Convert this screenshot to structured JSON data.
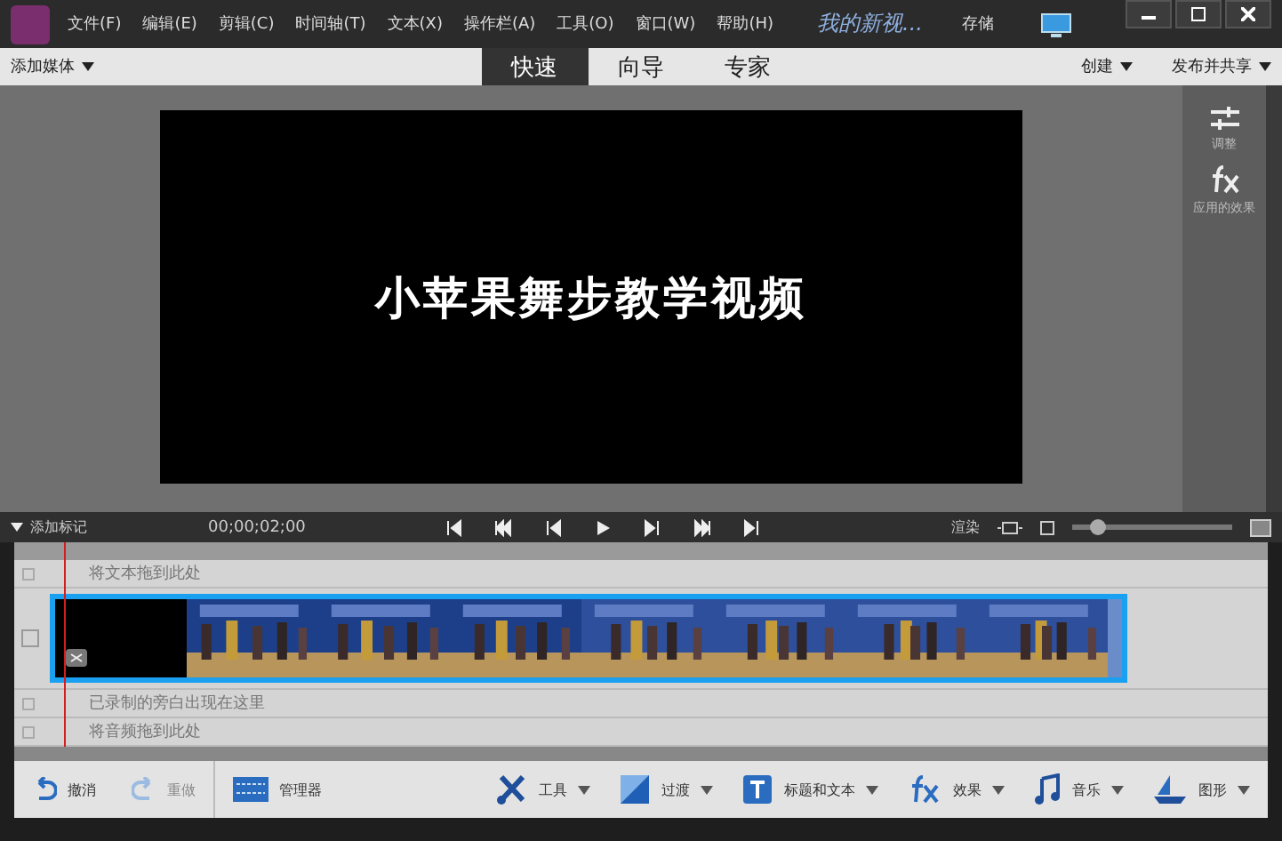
{
  "window": {
    "title": "我的新视...",
    "save": "存储"
  },
  "menu": [
    "文件(F)",
    "编辑(E)",
    "剪辑(C)",
    "时间轴(T)",
    "文本(X)",
    "操作栏(A)",
    "工具(O)",
    "窗口(W)",
    "帮助(H)"
  ],
  "toolbar": {
    "add_media": "添加媒体",
    "modes": [
      {
        "label": "快速",
        "selected": true
      },
      {
        "label": "向导",
        "selected": false
      },
      {
        "label": "专家",
        "selected": false
      }
    ],
    "create": "创建",
    "publish": "发布并共享"
  },
  "monitor": {
    "title_text": "小苹果舞步教学视频"
  },
  "side_panel": [
    {
      "kind": "adjust",
      "label": "调整"
    },
    {
      "kind": "fx",
      "label": "应用的效果"
    }
  ],
  "timeline": {
    "add_marker": "添加标记",
    "timecode": "00;00;02;00",
    "render": "渲染",
    "zoom": {
      "level": 0.15
    },
    "tracks": [
      {
        "kind": "text",
        "hint": "将文本拖到此处"
      },
      {
        "kind": "video",
        "clips": [
          {
            "kind": "black"
          },
          {
            "kind": "picture"
          },
          {
            "kind": "picture"
          },
          {
            "kind": "picture"
          },
          {
            "kind": "picture"
          },
          {
            "kind": "picture"
          },
          {
            "kind": "picture"
          },
          {
            "kind": "picture"
          }
        ]
      },
      {
        "kind": "narration",
        "hint": "已录制的旁白出现在这里"
      },
      {
        "kind": "audio",
        "hint": "将音频拖到此处"
      }
    ]
  },
  "bottom_bar": {
    "undo": "撤消",
    "redo": "重做",
    "organizer": "管理器",
    "tools": [
      {
        "kind": "tools",
        "label": "工具"
      },
      {
        "kind": "transitions",
        "label": "过渡"
      },
      {
        "kind": "titles",
        "label": "标题和文本"
      },
      {
        "kind": "fx",
        "label": "效果"
      },
      {
        "kind": "music",
        "label": "音乐"
      },
      {
        "kind": "graphics",
        "label": "图形"
      }
    ]
  }
}
